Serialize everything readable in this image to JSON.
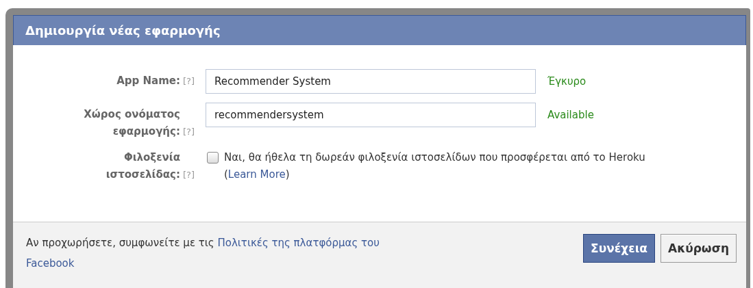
{
  "dialog": {
    "title": "Δημιουργία νέας εφαρμογής"
  },
  "fields": [
    {
      "kind": "text",
      "label": "App Name:",
      "help": "[?]",
      "value": "Recommender System",
      "status": "Έγκυρο"
    },
    {
      "kind": "text",
      "label": "Χώρος ονόματος εφαρμογής:",
      "help": "[?]",
      "value": "recommendersystem",
      "status": "Available"
    },
    {
      "kind": "checkbox",
      "label": "Φιλοξενία ιστοσελίδας:",
      "help": "[?]",
      "checked": false,
      "text": "Ναι, θα ήθελα τη δωρεάν φιλοξενία ιστοσελίδων που προσφέρεται από το Heroku (",
      "link": "Learn More",
      "after": ")"
    }
  ],
  "footer": {
    "text": "Αν προχωρήσετε, συμφωνείτε με τις",
    "link_lines": [
      "Πολιτικές της πλατφόρμας του",
      "Facebook"
    ]
  },
  "buttons": [
    {
      "label": "Συνέχεια",
      "primary": true
    },
    {
      "label": "Ακύρωση",
      "primary": false
    }
  ]
}
